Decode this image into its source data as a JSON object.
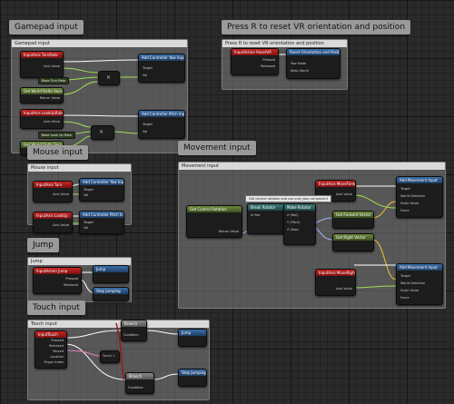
{
  "titles": {
    "gamepad": "Gamepad input",
    "reset_vr": "Press R to reset VR orientation and position",
    "mouse": "Mouse input",
    "movement": "Movement input",
    "jump": "Jump",
    "touch": "Touch input"
  },
  "comments": {
    "gamepad": "Gamepad input",
    "reset_vr": "Press R to reset VR orientation and position",
    "mouse": "Mouse input",
    "movement": "Movement input",
    "jump": "Jump",
    "touch": "Touch input"
  },
  "nodes": {
    "turn_rate": "InputAxis TurnRate",
    "look_up_rate": "InputAxis LookUpRate",
    "add_yaw_1": "Add Controller Yaw Input",
    "add_pitch_1": "Add Controller Pitch Input",
    "base_turn_rate": "Base Turn Rate",
    "base_look_up_rate": "Base Look Up Rate",
    "world_delta_1": "Get World Delta Seconds",
    "world_delta_2": "Get World Delta Seconds",
    "reset_vr_event": "InputAction ResetVR",
    "reset_vr_call": "Reset Orientation and Position",
    "turn": "InputAxis Turn",
    "look_up": "InputAxis LookUp",
    "add_yaw_2": "Add Controller Yaw Input",
    "add_pitch_2": "Add Controller Pitch Input",
    "move_forward": "InputAxis MoveForward",
    "move_right": "InputAxis MoveRight",
    "get_control_rotation": "Get Control Rotation",
    "break_rotator": "Break Rotator",
    "make_rotator": "Make Rotator",
    "get_forward_vector": "Get Forward Vector",
    "get_right_vector": "Get Right Vector",
    "add_movement_1": "Add Movement Input",
    "add_movement_2": "Add Movement Input",
    "jump_event": "InputAction Jump",
    "jump_call": "Jump",
    "stop_jumping": "Stop Jumping",
    "touch_event": "InputTouch",
    "jump_call_2": "Jump",
    "stop_jumping_2": "Stop Jumping",
    "branch_1": "Branch",
    "branch_2": "Branch",
    "move_note": "Get control rotation and use only yaw component"
  },
  "pins": {
    "axis_value": "Axis Value",
    "return_value": "Return Value",
    "target": "Target",
    "self": "self",
    "val": "Val",
    "pressed": "Pressed",
    "released": "Released",
    "key": "Key",
    "condition": "Condition",
    "true": "True",
    "false": "False",
    "world_direction": "World Direction",
    "scale_value": "Scale Value",
    "force": "Force",
    "in_rot": "In Rot",
    "roll": "X (Roll)",
    "pitch": "Y (Pitch)",
    "yaw": "Z (Yaw)",
    "moved": "Moved",
    "location": "Location",
    "finger_index": "Finger Index",
    "touch_1": "Touch 1",
    "yaw_mode": "Yaw Mode",
    "keep_world": "Keep World"
  },
  "colors": {
    "exec": "#ffffff",
    "float": "#9ee054",
    "vector": "#f2c52e",
    "rotator": "#9fb3ff",
    "bool": "#9b1b1b",
    "key": "#e580b8"
  }
}
